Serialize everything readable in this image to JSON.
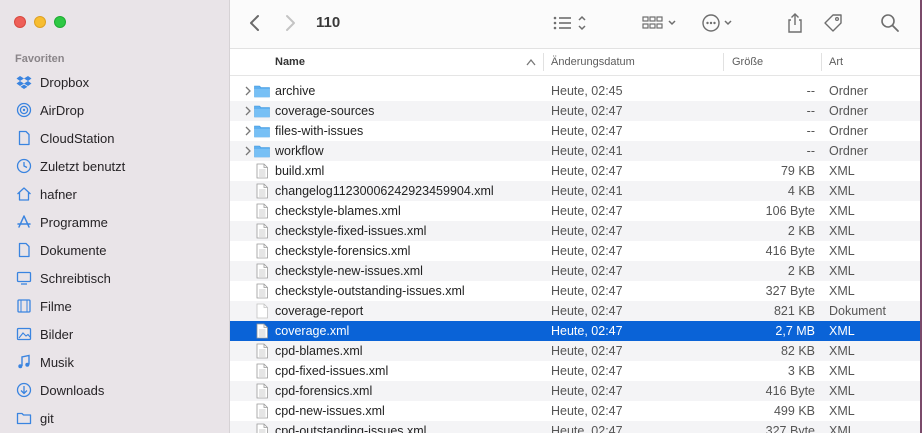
{
  "window": {
    "title": "110"
  },
  "sidebar": {
    "section": "Favoriten",
    "items": [
      {
        "label": "Dropbox",
        "icon": "dropbox-icon"
      },
      {
        "label": "AirDrop",
        "icon": "airdrop-icon"
      },
      {
        "label": "CloudStation",
        "icon": "document-icon"
      },
      {
        "label": "Zuletzt benutzt",
        "icon": "clock-icon"
      },
      {
        "label": "hafner",
        "icon": "home-icon"
      },
      {
        "label": "Programme",
        "icon": "apps-icon"
      },
      {
        "label": "Dokumente",
        "icon": "document-icon"
      },
      {
        "label": "Schreibtisch",
        "icon": "desktop-icon"
      },
      {
        "label": "Filme",
        "icon": "film-icon"
      },
      {
        "label": "Bilder",
        "icon": "photo-icon"
      },
      {
        "label": "Musik",
        "icon": "music-icon"
      },
      {
        "label": "Downloads",
        "icon": "download-icon"
      },
      {
        "label": "git",
        "icon": "folder-icon"
      }
    ]
  },
  "columns": {
    "name": "Name",
    "date": "Änderungsdatum",
    "size": "Größe",
    "kind": "Art"
  },
  "files": [
    {
      "name": "archive",
      "date": "Heute, 02:45",
      "size": "--",
      "kind": "Ordner",
      "type": "folder"
    },
    {
      "name": "coverage-sources",
      "date": "Heute, 02:47",
      "size": "--",
      "kind": "Ordner",
      "type": "folder"
    },
    {
      "name": "files-with-issues",
      "date": "Heute, 02:47",
      "size": "--",
      "kind": "Ordner",
      "type": "folder"
    },
    {
      "name": "workflow",
      "date": "Heute, 02:41",
      "size": "--",
      "kind": "Ordner",
      "type": "folder"
    },
    {
      "name": "build.xml",
      "date": "Heute, 02:47",
      "size": "79 KB",
      "kind": "XML",
      "type": "file"
    },
    {
      "name": "changelog11230006242923459904.xml",
      "date": "Heute, 02:41",
      "size": "4 KB",
      "kind": "XML",
      "type": "file"
    },
    {
      "name": "checkstyle-blames.xml",
      "date": "Heute, 02:47",
      "size": "106 Byte",
      "kind": "XML",
      "type": "file"
    },
    {
      "name": "checkstyle-fixed-issues.xml",
      "date": "Heute, 02:47",
      "size": "2 KB",
      "kind": "XML",
      "type": "file"
    },
    {
      "name": "checkstyle-forensics.xml",
      "date": "Heute, 02:47",
      "size": "416 Byte",
      "kind": "XML",
      "type": "file"
    },
    {
      "name": "checkstyle-new-issues.xml",
      "date": "Heute, 02:47",
      "size": "2 KB",
      "kind": "XML",
      "type": "file"
    },
    {
      "name": "checkstyle-outstanding-issues.xml",
      "date": "Heute, 02:47",
      "size": "327 Byte",
      "kind": "XML",
      "type": "file"
    },
    {
      "name": "coverage-report",
      "date": "Heute, 02:47",
      "size": "821 KB",
      "kind": "Dokument",
      "type": "blank"
    },
    {
      "name": "coverage.xml",
      "date": "Heute, 02:47",
      "size": "2,7 MB",
      "kind": "XML",
      "type": "file",
      "selected": true
    },
    {
      "name": "cpd-blames.xml",
      "date": "Heute, 02:47",
      "size": "82 KB",
      "kind": "XML",
      "type": "file"
    },
    {
      "name": "cpd-fixed-issues.xml",
      "date": "Heute, 02:47",
      "size": "3 KB",
      "kind": "XML",
      "type": "file"
    },
    {
      "name": "cpd-forensics.xml",
      "date": "Heute, 02:47",
      "size": "416 Byte",
      "kind": "XML",
      "type": "file"
    },
    {
      "name": "cpd-new-issues.xml",
      "date": "Heute, 02:47",
      "size": "499 KB",
      "kind": "XML",
      "type": "file"
    },
    {
      "name": "cpd-outstanding-issues.xml",
      "date": "Heute, 02:47",
      "size": "327 Byte",
      "kind": "XML",
      "type": "file"
    }
  ],
  "colors": {
    "accent": "#0a63d7",
    "folder": "#5fb0f0",
    "sidebar_icon": "#3a84e0"
  }
}
